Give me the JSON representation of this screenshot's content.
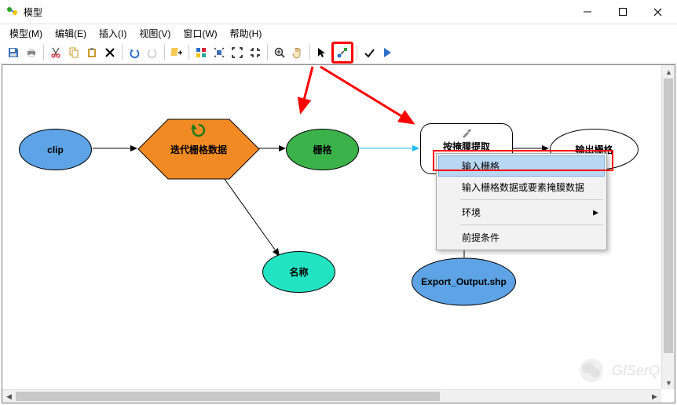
{
  "window": {
    "title": "模型"
  },
  "menu": {
    "model": "模型(M)",
    "edit": "编辑(E)",
    "insert": "插入(I)",
    "view": "视图(V)",
    "window": "窗口(W)",
    "help": "帮助(H)"
  },
  "flow": {
    "clip": "clip",
    "iterator": "迭代栅格数据",
    "raster": "栅格",
    "mask_tool": "按掩膜提取",
    "output_raster": "输出栅格",
    "name": "名称",
    "export": "Export_Output.shp"
  },
  "context": {
    "input_raster": "输入栅格",
    "input_mask": "输入栅格数据或要素掩膜数据",
    "environment": "环境",
    "precondition": "前提条件"
  },
  "watermark": {
    "text": "GISerQ"
  }
}
